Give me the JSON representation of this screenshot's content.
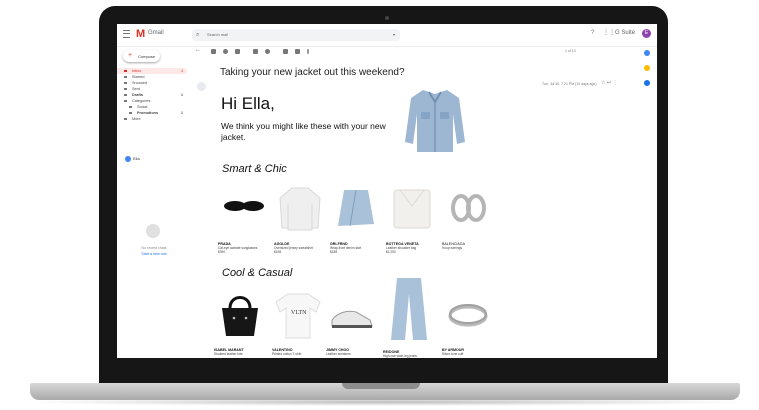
{
  "app": {
    "logo_text": "Gmail",
    "search_placeholder": "Search mail",
    "brand": "G Suite",
    "avatar_letter": "E"
  },
  "sidebar": {
    "compose_label": "Compose",
    "items": [
      {
        "label": "Inbox",
        "count": "4",
        "active": true
      },
      {
        "label": "Starred",
        "count": ""
      },
      {
        "label": "Snoozed",
        "count": ""
      },
      {
        "label": "Sent",
        "count": ""
      },
      {
        "label": "Drafts",
        "count": "1"
      },
      {
        "label": "Categories",
        "count": ""
      },
      {
        "label": "Social",
        "count": ""
      },
      {
        "label": "Promotions",
        "count": "1"
      },
      {
        "label": "More",
        "count": ""
      }
    ],
    "user_label": "Ella",
    "chat_empty": "No recent chats",
    "chat_link": "Start a new one"
  },
  "toolbar": {
    "pager": "1 of 10"
  },
  "email": {
    "subject": "Taking your new jacket out this weekend?",
    "date": "Tue, Jul 30, 7:21 PM (10 days ago)",
    "greeting": "Hi Ella,",
    "intro": "We think you might like these with your new jacket."
  },
  "sections": [
    {
      "title": "Smart & Chic",
      "products": [
        {
          "name": "PRADA",
          "desc": "Cat-eye acetate sunglasses",
          "price": "$390"
        },
        {
          "name": "AGOLDE",
          "desc": "Oversized jersey sweatshirt",
          "price": "$198"
        },
        {
          "name": "GRLFRND",
          "desc": "Wrap-front denim skirt",
          "price": "$188"
        },
        {
          "name": "BOTTEGA VENETA",
          "desc": "Leather shoulder bag",
          "price": "$1,250"
        },
        {
          "name": "BALENCIAGA",
          "desc": "Hoop earrings",
          "price": ""
        }
      ]
    },
    {
      "title": "Cool & Casual",
      "products": [
        {
          "name": "ISABEL MARANT",
          "desc": "Studded leather tote",
          "price": ""
        },
        {
          "name": "VALENTINO",
          "desc": "Printed cotton T-shirt",
          "price": ""
        },
        {
          "name": "JIMMY CHOO",
          "desc": "Leather sneakers",
          "price": ""
        },
        {
          "name": "RE/DONE",
          "desc": "High-rise wide-leg jeans",
          "price": ""
        },
        {
          "name": "BY ARMOUR",
          "desc": "Silver-tone cuff",
          "price": ""
        }
      ]
    }
  ],
  "colors": {
    "accent_red": "#d93025",
    "avatar": "#8e44ad"
  }
}
